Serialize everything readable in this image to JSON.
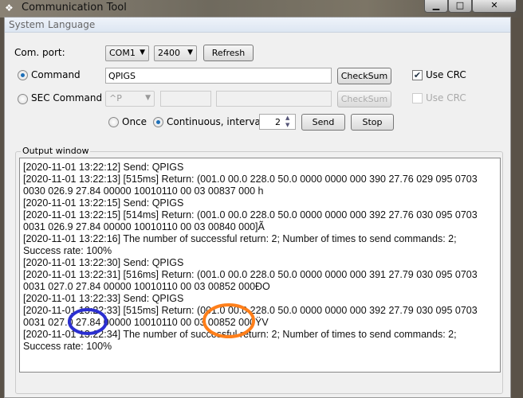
{
  "window": {
    "title": "Communication Tool",
    "minimize": "▁",
    "maximize": "□",
    "close": "✕"
  },
  "menu": [
    "System",
    "Language"
  ],
  "com_port": {
    "label": "Com. port:",
    "port": "COM1",
    "baud": "2400",
    "refresh": "Refresh"
  },
  "command": {
    "label": "Command",
    "selected": true,
    "value": "QPIGS",
    "checksum": "CheckSum",
    "use_crc_label": "Use CRC",
    "use_crc": true
  },
  "sec_command": {
    "label": "SEC Command",
    "selected": false,
    "combo": "^P",
    "value1": "",
    "value2": "",
    "checksum": "CheckSum",
    "use_crc_label": "Use CRC",
    "use_crc": false
  },
  "send_mode": {
    "once": "Once",
    "continuous": "Continuous, interval",
    "selected": "continuous",
    "interval": "2",
    "send": "Send",
    "stop": "Stop"
  },
  "output": {
    "caption": "Output window",
    "lines": [
      "[2020-11-01 13:22:12] Send: QPIGS",
      "[2020-11-01 13:22:13] [515ms] Return: (001.0 00.0 228.0 50.0 0000 0000 000 390 27.76 029 095 0703",
      "0030 026.9 27.84 00000 10010110 00 03 00837 000  h",
      "[2020-11-01 13:22:15] Send: QPIGS",
      "[2020-11-01 13:22:15] [514ms] Return: (001.0 00.0 228.0 50.0 0000 0000 000 392 27.76 030 095 0703",
      "0031 026.9 27.84 00000 10010110 00 03 00840 000]Ã",
      "[2020-11-01 13:22:16] The number of successful return: 2; Number of times to send commands: 2;",
      "Success rate: 100%",
      "[2020-11-01 13:22:30] Send: QPIGS",
      "[2020-11-01 13:22:31] [516ms] Return: (001.0 00.0 228.0 50.0 0000 0000 000 391 27.79 030 095 0703",
      "0031 027.0 27.84 00000 10010110 00 03 00852 000ÐO",
      "[2020-11-01 13:22:33] Send: QPIGS",
      "[2020-11-01 13:22:33] [515ms] Return: (001.0 00.0 228.0 50.0 0000 0000 000 392 27.79 030 095 0703",
      "0031 027.0 27.84 00000 10010110 00 03 00852 000ŸV",
      "[2020-11-01 13:22:34] The number of successful return: 2; Number of times to send commands: 2;",
      "Success rate: 100%"
    ]
  },
  "annotations": {
    "blue": "#2b2fd0",
    "orange": "#ff7f1a"
  }
}
